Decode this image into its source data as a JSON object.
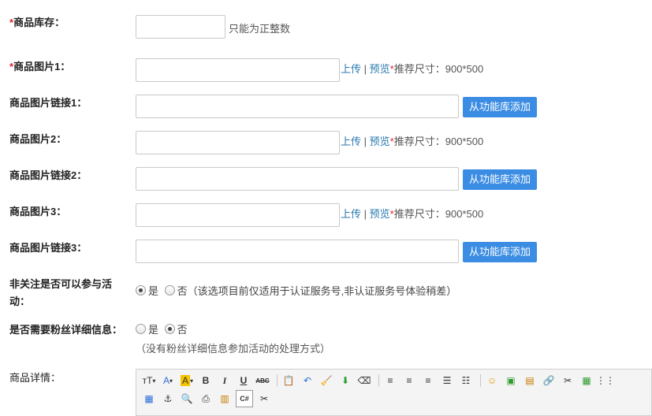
{
  "stock": {
    "label": "商品库存：",
    "hint": "只能为正整数"
  },
  "image1": {
    "label": "商品图片1：",
    "upload": "上传",
    "sep": "|",
    "preview": "预览",
    "star": "*",
    "size_hint": "推荐尺寸：900*500"
  },
  "link1": {
    "label": "商品图片链接1：",
    "button": "从功能库添加"
  },
  "image2": {
    "label": "商品图片2：",
    "upload": "上传",
    "sep": "|",
    "preview": "预览",
    "star": "*",
    "size_hint": "推荐尺寸：900*500"
  },
  "link2": {
    "label": "商品图片链接2：",
    "button": "从功能库添加"
  },
  "image3": {
    "label": "商品图片3：",
    "upload": "上传",
    "sep": "|",
    "preview": "预览",
    "star": "*",
    "size_hint": "推荐尺寸：900*500"
  },
  "link3": {
    "label": "商品图片链接3：",
    "button": "从功能库添加"
  },
  "nonfollow": {
    "label_line1": "非关注是否可以参与活",
    "label_line2": "动：",
    "yes": "是",
    "no": "否",
    "note": "（该选项目前仅适用于认证服务号,非认证服务号体验稍差）",
    "selected": "yes"
  },
  "fans": {
    "label": "是否需要粉丝详细信息：",
    "yes": "是",
    "no": "否",
    "note": "（没有粉丝详细信息参加活动的处理方式）",
    "selected": "no"
  },
  "detail": {
    "label": "商品详情：",
    "toolbar_row1": [
      "font-size-icon",
      "font-color-icon",
      "highlight-icon",
      "bold-icon",
      "italic-icon",
      "underline-icon",
      "strikethrough-icon",
      "paste-icon",
      "undo-icon",
      "clear-format-icon",
      "insert-icon",
      "eraser-icon",
      "align-left-icon",
      "align-center-icon",
      "align-right-icon",
      "ordered-list-icon",
      "unordered-list-icon",
      "emoji-icon",
      "image-upload-icon",
      "image-multi-icon",
      "link-icon",
      "unlink-icon",
      "picture-icon",
      "table-grid-icon"
    ],
    "toolbar_row2": [
      "table-icon",
      "anchor-icon",
      "preview-icon",
      "print-icon",
      "template-icon",
      "code-icon",
      "cut-icon"
    ],
    "glyphs": {
      "bold": "B",
      "italic": "I",
      "underline": "U",
      "strike": "ABC",
      "fontsize": "тT",
      "fontcolor": "A",
      "highlight": "A",
      "code": "C#"
    }
  },
  "colors": {
    "required": "#d9262c",
    "link": "#2a7ab0",
    "button": "#3b8de3"
  }
}
